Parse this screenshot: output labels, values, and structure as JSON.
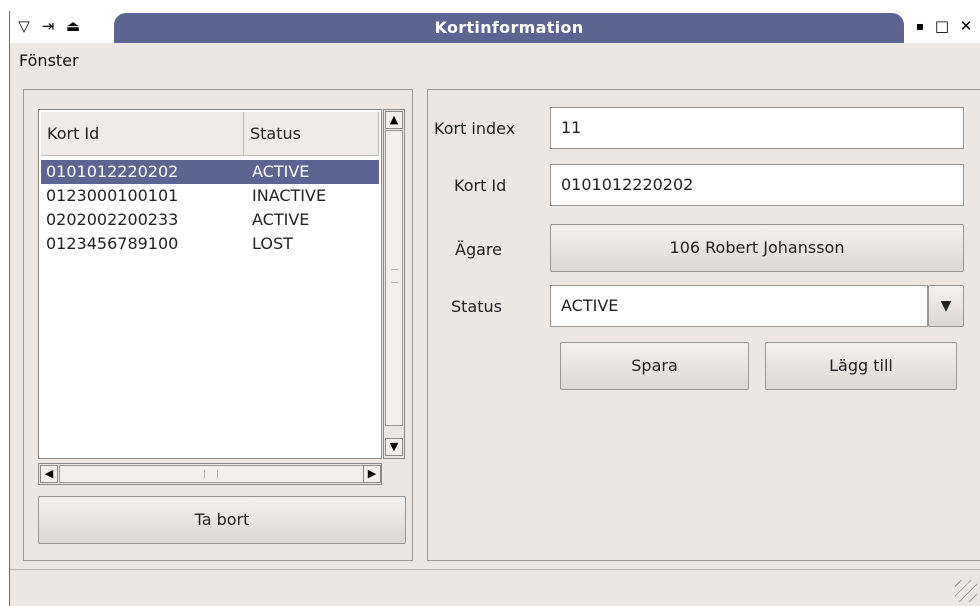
{
  "window": {
    "title": "Kortinformation",
    "titlebar_left_icons": [
      "menu-down-icon",
      "pin-icon",
      "shade-icon"
    ],
    "titlebar_right_icons": [
      "minimize-icon",
      "maximize-icon",
      "close-icon"
    ],
    "left_glyphs": [
      "▽",
      "⇥",
      "⏏"
    ],
    "right_glyphs": [
      "▪",
      "□",
      "✕"
    ]
  },
  "menu": {
    "items": [
      {
        "label": "Fönster"
      }
    ]
  },
  "card_list": {
    "columns": [
      "Kort Id",
      "Status"
    ],
    "rows": [
      {
        "id": "0101012220202",
        "status": "ACTIVE",
        "selected": true
      },
      {
        "id": "0123000100101",
        "status": "INACTIVE",
        "selected": false
      },
      {
        "id": "0202002200233",
        "status": "ACTIVE",
        "selected": false
      },
      {
        "id": "0123456789100",
        "status": "LOST",
        "selected": false
      }
    ],
    "delete_button": "Ta bort"
  },
  "form": {
    "index_label": "Kort index",
    "index_value": "11",
    "id_label": "Kort Id",
    "id_value": "0101012220202",
    "owner_label": "Ägare",
    "owner_value": "106 Robert Johansson",
    "status_label": "Status",
    "status_value": "ACTIVE",
    "save_button": "Spara",
    "add_button": "Lägg till"
  },
  "colors": {
    "selection": "#5c6592",
    "titlebar": "#5c6592",
    "background": "#ece7e3"
  }
}
